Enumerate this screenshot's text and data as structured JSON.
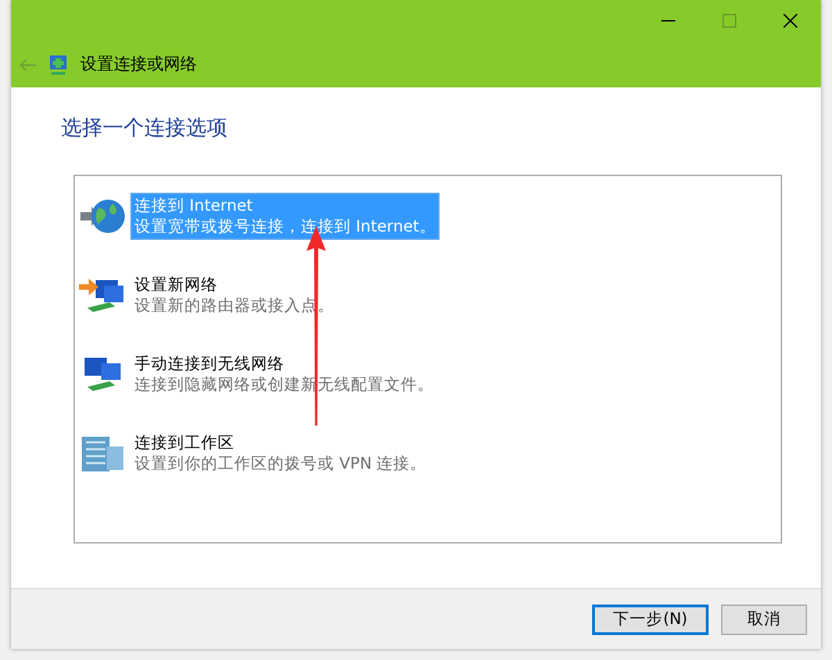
{
  "window": {
    "title": "设置连接或网络"
  },
  "heading": "选择一个连接选项",
  "options": [
    {
      "title": "连接到 Internet",
      "description": "设置宽带或拨号连接，连接到 Internet。",
      "kind": "globe",
      "selected": true
    },
    {
      "title": "设置新网络",
      "description": "设置新的路由器或接入点。",
      "kind": "router",
      "selected": false
    },
    {
      "title": "手动连接到无线网络",
      "description": "连接到隐藏网络或创建新无线配置文件。",
      "kind": "wireless",
      "selected": false
    },
    {
      "title": "连接到工作区",
      "description": "设置到你的工作区的拨号或 VPN 连接。",
      "kind": "workplace",
      "selected": false
    }
  ],
  "buttons": [
    {
      "label": "下一步(N)",
      "default": true
    },
    {
      "label": "取消",
      "default": false
    }
  ]
}
